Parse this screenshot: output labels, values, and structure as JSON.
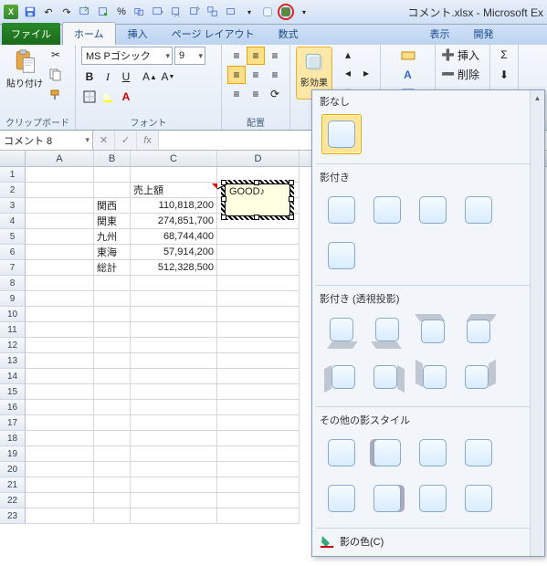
{
  "app": {
    "title": "コメント.xlsx - Microsoft Ex"
  },
  "tabs": {
    "file": "ファイル",
    "home": "ホーム",
    "insert": "挿入",
    "layout": "ページ レイアウト",
    "formulas": "数式",
    "view": "表示",
    "dev": "開発"
  },
  "ribbon": {
    "clipboard": {
      "paste": "貼り付け",
      "group": "クリップボード"
    },
    "font": {
      "name": "MS Pゴシック",
      "size": "9",
      "group": "フォント"
    },
    "align": {
      "group": "配置"
    },
    "shadow": {
      "label": "影効果"
    },
    "cells": {
      "insert": "挿入",
      "delete": "削除"
    }
  },
  "namebox": "コメント 8",
  "sheet": {
    "cols": [
      "A",
      "B",
      "C",
      "D"
    ],
    "c2": "売上額",
    "b3": "関西",
    "c3": "110,818,200",
    "b4": "関東",
    "c4": "274,851,700",
    "b5": "九州",
    "c5": "68,744,400",
    "b6": "東海",
    "c6": "57,914,200",
    "b7": "総計",
    "c7": "512,328,500",
    "comment": "GOOD♪"
  },
  "gallery": {
    "sec1": "影なし",
    "sec2": "影付き",
    "sec3": "影付き (透視投影)",
    "sec4": "その他の影スタイル",
    "footer": "影の色(C)"
  }
}
